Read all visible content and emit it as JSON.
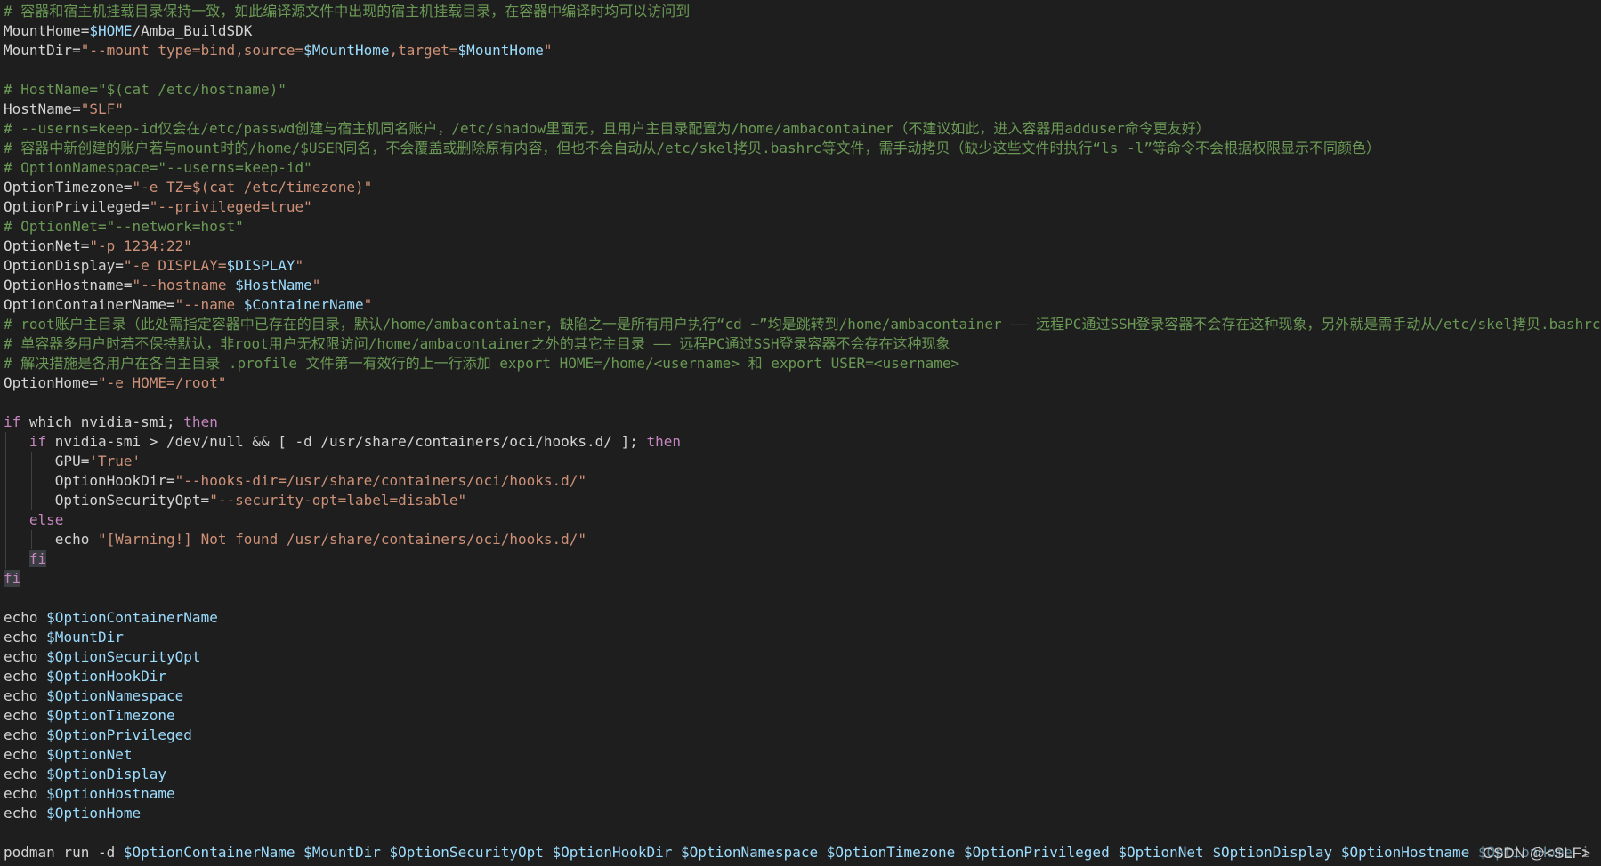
{
  "colors": {
    "background": "#1e1e1e",
    "comment": "#6a9955",
    "variable": "#9cdcfe",
    "string": "#ce9178",
    "keyword": "#c586c0",
    "plain": "#d4d4d4"
  },
  "watermark": "CSDN @<SLF>",
  "lines": [
    {
      "indent": 0,
      "tokens": [
        [
          "comment",
          "# 容器和宿主机挂载目录保持一致，如此编译源文件中出现的宿主机挂载目录，在容器中编译时均可以访问到"
        ]
      ]
    },
    {
      "indent": 0,
      "tokens": [
        [
          "plain",
          "MountHome="
        ],
        [
          "var",
          "$HOME"
        ],
        [
          "plain",
          "/Amba_BuildSDK"
        ]
      ]
    },
    {
      "indent": 0,
      "tokens": [
        [
          "plain",
          "MountDir="
        ],
        [
          "string",
          "\"--mount type=bind,source="
        ],
        [
          "var",
          "$MountHome"
        ],
        [
          "string",
          ",target="
        ],
        [
          "var",
          "$MountHome"
        ],
        [
          "string",
          "\""
        ]
      ]
    },
    {
      "indent": 0,
      "tokens": []
    },
    {
      "indent": 0,
      "tokens": [
        [
          "comment",
          "# HostName=\"$(cat /etc/hostname)\""
        ]
      ]
    },
    {
      "indent": 0,
      "tokens": [
        [
          "plain",
          "HostName="
        ],
        [
          "string",
          "\"SLF\""
        ]
      ]
    },
    {
      "indent": 0,
      "tokens": [
        [
          "comment",
          "# --userns=keep-id仅会在/etc/passwd创建与宿主机同名账户，/etc/shadow里面无，且用户主目录配置为/home/ambacontainer（不建议如此，进入容器用adduser命令更友好）"
        ]
      ]
    },
    {
      "indent": 0,
      "tokens": [
        [
          "comment",
          "# 容器中新创建的账户若与mount时的/home/$USER同名，不会覆盖或删除原有内容，但也不会自动从/etc/skel拷贝.bashrc等文件，需手动拷贝（缺少这些文件时执行“ls -l”等命令不会根据权限显示不同颜色）"
        ]
      ]
    },
    {
      "indent": 0,
      "tokens": [
        [
          "comment",
          "# OptionNamespace=\"--userns=keep-id\""
        ]
      ]
    },
    {
      "indent": 0,
      "tokens": [
        [
          "plain",
          "OptionTimezone="
        ],
        [
          "string",
          "\"-e TZ=$(cat /etc/timezone)\""
        ]
      ]
    },
    {
      "indent": 0,
      "tokens": [
        [
          "plain",
          "OptionPrivileged="
        ],
        [
          "string",
          "\"--privileged=true\""
        ]
      ]
    },
    {
      "indent": 0,
      "tokens": [
        [
          "comment",
          "# OptionNet=\"--network=host\""
        ]
      ]
    },
    {
      "indent": 0,
      "tokens": [
        [
          "plain",
          "OptionNet="
        ],
        [
          "string",
          "\"-p 1234:22\""
        ]
      ]
    },
    {
      "indent": 0,
      "tokens": [
        [
          "plain",
          "OptionDisplay="
        ],
        [
          "string",
          "\"-e DISPLAY="
        ],
        [
          "var",
          "$DISPLAY"
        ],
        [
          "string",
          "\""
        ]
      ]
    },
    {
      "indent": 0,
      "tokens": [
        [
          "plain",
          "OptionHostname="
        ],
        [
          "string",
          "\"--hostname "
        ],
        [
          "var",
          "$HostName"
        ],
        [
          "string",
          "\""
        ]
      ]
    },
    {
      "indent": 0,
      "tokens": [
        [
          "plain",
          "OptionContainerName="
        ],
        [
          "string",
          "\"--name "
        ],
        [
          "var",
          "$ContainerName"
        ],
        [
          "string",
          "\""
        ]
      ]
    },
    {
      "indent": 0,
      "tokens": [
        [
          "comment",
          "# root账户主目录（此处需指定容器中已存在的目录，默认/home/ambacontainer，缺陷之一是所有用户执行“cd ~”均是跳转到/home/ambacontainer —— 远程PC通过SSH登录容器不会存在这种现象，另外就是需手动从/etc/skel拷贝.bashrc"
        ]
      ]
    },
    {
      "indent": 0,
      "tokens": [
        [
          "comment",
          "# 单容器多用户时若不保持默认，非root用户无权限访问/home/ambacontainer之外的其它主目录 —— 远程PC通过SSH登录容器不会存在这种现象"
        ]
      ]
    },
    {
      "indent": 0,
      "tokens": [
        [
          "comment",
          "# 解决措施是各用户在各自主目录 .profile 文件第一有效行的上一行添加 export HOME=/home/<username> 和 export USER=<username>"
        ]
      ]
    },
    {
      "indent": 0,
      "tokens": [
        [
          "plain",
          "OptionHome="
        ],
        [
          "string",
          "\"-e HOME=/root\""
        ]
      ]
    },
    {
      "indent": 0,
      "tokens": []
    },
    {
      "indent": 0,
      "tokens": [
        [
          "keyword",
          "if"
        ],
        [
          "plain",
          " which nvidia-smi; "
        ],
        [
          "keyword",
          "then"
        ]
      ]
    },
    {
      "indent": 1,
      "tokens": [
        [
          "keyword",
          "if"
        ],
        [
          "plain",
          " nvidia-smi > /dev/null && [ -d /usr/share/containers/oci/hooks.d/ ]; "
        ],
        [
          "keyword",
          "then"
        ]
      ]
    },
    {
      "indent": 2,
      "tokens": [
        [
          "plain",
          "GPU="
        ],
        [
          "string",
          "'True'"
        ]
      ]
    },
    {
      "indent": 2,
      "tokens": [
        [
          "plain",
          "OptionHookDir="
        ],
        [
          "string",
          "\"--hooks-dir=/usr/share/containers/oci/hooks.d/\""
        ]
      ]
    },
    {
      "indent": 2,
      "tokens": [
        [
          "plain",
          "OptionSecurityOpt="
        ],
        [
          "string",
          "\"--security-opt=label=disable\""
        ]
      ]
    },
    {
      "indent": 1,
      "tokens": [
        [
          "keyword",
          "else"
        ]
      ]
    },
    {
      "indent": 2,
      "tokens": [
        [
          "plain",
          "echo "
        ],
        [
          "string",
          "\"[Warning!] Not found /usr/share/containers/oci/hooks.d/\""
        ]
      ]
    },
    {
      "indent": 1,
      "tokens": [
        [
          "keyword hl",
          "fi"
        ]
      ]
    },
    {
      "indent": 0,
      "tokens": [
        [
          "keyword hl",
          "fi"
        ]
      ]
    },
    {
      "indent": 0,
      "tokens": []
    },
    {
      "indent": 0,
      "tokens": [
        [
          "plain",
          "echo "
        ],
        [
          "var",
          "$OptionContainerName"
        ]
      ]
    },
    {
      "indent": 0,
      "tokens": [
        [
          "plain",
          "echo "
        ],
        [
          "var",
          "$MountDir"
        ]
      ]
    },
    {
      "indent": 0,
      "tokens": [
        [
          "plain",
          "echo "
        ],
        [
          "var",
          "$OptionSecurityOpt"
        ]
      ]
    },
    {
      "indent": 0,
      "tokens": [
        [
          "plain",
          "echo "
        ],
        [
          "var",
          "$OptionHookDir"
        ]
      ]
    },
    {
      "indent": 0,
      "tokens": [
        [
          "plain",
          "echo "
        ],
        [
          "var",
          "$OptionNamespace"
        ]
      ]
    },
    {
      "indent": 0,
      "tokens": [
        [
          "plain",
          "echo "
        ],
        [
          "var",
          "$OptionTimezone"
        ]
      ]
    },
    {
      "indent": 0,
      "tokens": [
        [
          "plain",
          "echo "
        ],
        [
          "var",
          "$OptionPrivileged"
        ]
      ]
    },
    {
      "indent": 0,
      "tokens": [
        [
          "plain",
          "echo "
        ],
        [
          "var",
          "$OptionNet"
        ]
      ]
    },
    {
      "indent": 0,
      "tokens": [
        [
          "plain",
          "echo "
        ],
        [
          "var",
          "$OptionDisplay"
        ]
      ]
    },
    {
      "indent": 0,
      "tokens": [
        [
          "plain",
          "echo "
        ],
        [
          "var",
          "$OptionHostname"
        ]
      ]
    },
    {
      "indent": 0,
      "tokens": [
        [
          "plain",
          "echo "
        ],
        [
          "var",
          "$OptionHome"
        ]
      ]
    },
    {
      "indent": 0,
      "tokens": []
    },
    {
      "indent": 0,
      "tokens": [
        [
          "plain",
          "podman run -d "
        ],
        [
          "var",
          "$OptionContainerName"
        ],
        [
          "plain",
          " "
        ],
        [
          "var",
          "$MountDir"
        ],
        [
          "plain",
          " "
        ],
        [
          "var",
          "$OptionSecurityOpt"
        ],
        [
          "plain",
          " "
        ],
        [
          "var",
          "$OptionHookDir"
        ],
        [
          "plain",
          " "
        ],
        [
          "var",
          "$OptionNamespace"
        ],
        [
          "plain",
          " "
        ],
        [
          "var",
          "$OptionTimezone"
        ],
        [
          "plain",
          " "
        ],
        [
          "var",
          "$OptionPrivileged"
        ],
        [
          "plain",
          " "
        ],
        [
          "var",
          "$OptionNet"
        ],
        [
          "plain",
          " "
        ],
        [
          "var",
          "$OptionDisplay"
        ],
        [
          "plain",
          " "
        ],
        [
          "var",
          "$OptionHostname"
        ],
        [
          "plain",
          " "
        ],
        [
          "var",
          "$OptionHome"
        ],
        [
          "plain",
          " i"
        ]
      ]
    }
  ]
}
